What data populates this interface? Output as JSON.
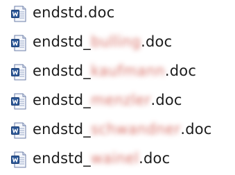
{
  "files": [
    {
      "prefix": "endstd",
      "redacted": "",
      "ext": ".doc",
      "icon": "word-doc-icon"
    },
    {
      "prefix": "endstd_",
      "redacted": "bulling",
      "ext": ".doc",
      "icon": "word-doc-icon"
    },
    {
      "prefix": "endstd_",
      "redacted": "kaufmann",
      "ext": ".doc",
      "icon": "word-doc-icon"
    },
    {
      "prefix": "endstd_",
      "redacted": "menzler",
      "ext": ".doc",
      "icon": "word-doc-icon"
    },
    {
      "prefix": "endstd_",
      "redacted": "schwandner",
      "ext": ".doc",
      "icon": "word-doc-icon"
    },
    {
      "prefix": "endstd_",
      "redacted": "wainel",
      "ext": ".doc",
      "icon": "word-doc-icon"
    }
  ],
  "colors": {
    "icon_blue": "#2b5797",
    "icon_page": "#f4f6fb",
    "text": "#1c1c1c",
    "redaction_blur": "#d25a50"
  }
}
